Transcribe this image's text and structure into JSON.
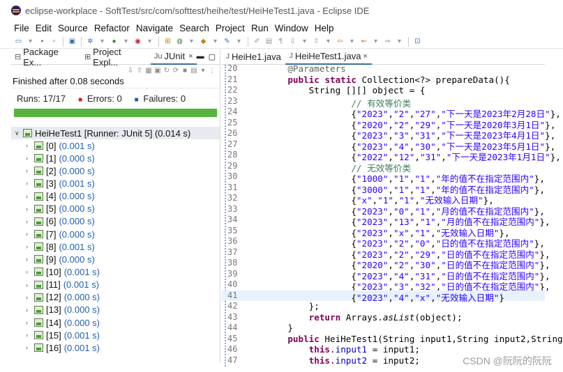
{
  "window": {
    "title": "eclipse-workplace - SoftTest/src/com/softtest/heihe/test/HeiHeTest1.java - Eclipse IDE"
  },
  "menu": [
    "File",
    "Edit",
    "Source",
    "Refactor",
    "Navigate",
    "Search",
    "Project",
    "Run",
    "Window",
    "Help"
  ],
  "left_tabs": [
    {
      "label": "Package Ex...",
      "icon": "package-explorer-icon"
    },
    {
      "label": "Project Expl...",
      "icon": "project-explorer-icon"
    },
    {
      "label": "JUnit",
      "icon": "junit-icon",
      "close": "×"
    }
  ],
  "junit": {
    "finished": "Finished after 0.08 seconds",
    "runs_label": "Runs:",
    "runs": "17/17",
    "errors_label": "Errors:",
    "errors": "0",
    "failures_label": "Failures:",
    "failures": "0",
    "progress": 1.0,
    "root": "HeiHeTest1 [Runner: JUnit 5] (0.014 s)",
    "cases": [
      {
        "name": "[0]",
        "time": "(0.001 s)"
      },
      {
        "name": "[1]",
        "time": "(0.000 s)"
      },
      {
        "name": "[2]",
        "time": "(0.000 s)"
      },
      {
        "name": "[3]",
        "time": "(0.001 s)"
      },
      {
        "name": "[4]",
        "time": "(0.000 s)"
      },
      {
        "name": "[5]",
        "time": "(0.000 s)"
      },
      {
        "name": "[6]",
        "time": "(0.000 s)"
      },
      {
        "name": "[7]",
        "time": "(0.000 s)"
      },
      {
        "name": "[8]",
        "time": "(0.001 s)"
      },
      {
        "name": "[9]",
        "time": "(0.000 s)"
      },
      {
        "name": "[10]",
        "time": "(0.001 s)"
      },
      {
        "name": "[11]",
        "time": "(0.001 s)"
      },
      {
        "name": "[12]",
        "time": "(0.000 s)"
      },
      {
        "name": "[13]",
        "time": "(0.000 s)"
      },
      {
        "name": "[14]",
        "time": "(0.000 s)"
      },
      {
        "name": "[15]",
        "time": "(0.001 s)"
      },
      {
        "name": "[16]",
        "time": "(0.001 s)"
      }
    ]
  },
  "editor_tabs": [
    {
      "label": "HeiHe1.java"
    },
    {
      "label": "HeiHeTest1.java",
      "close": "×"
    }
  ],
  "code_lines": [
    {
      "num": "20",
      "text": "    @Parameters"
    },
    {
      "num": "21",
      "text": "    public static Collection<?> prepareData(){"
    },
    {
      "num": "22",
      "text": "        String [][] object = {"
    },
    {
      "num": "23",
      "text": "                // 有效等价类"
    },
    {
      "num": "24",
      "text": "                {\"2023\",\"2\",\"27\",\"下一天是2023年2月28日\"},"
    },
    {
      "num": "25",
      "text": "                {\"2020\",\"2\",\"29\",\"下一天是2020年3月1日\"},"
    },
    {
      "num": "26",
      "text": "                {\"2023\",\"3\",\"31\",\"下一天是2023年4月1日\"},"
    },
    {
      "num": "27",
      "text": "                {\"2023\",\"4\",\"30\",\"下一天是2023年5月1日\"},"
    },
    {
      "num": "28",
      "text": "                {\"2022\",\"12\",\"31\",\"下一天是2023年1月1日\"},"
    },
    {
      "num": "29",
      "text": "                // 无效等价类"
    },
    {
      "num": "30",
      "text": "                {\"1000\",\"1\",\"1\",\"年的值不在指定范围内\"},"
    },
    {
      "num": "31",
      "text": "                {\"3000\",\"1\",\"1\",\"年的值不在指定范围内\"},"
    },
    {
      "num": "32",
      "text": "                {\"x\",\"1\",\"1\",\"无效输入日期\"},"
    },
    {
      "num": "33",
      "text": "                {\"2023\",\"0\",\"1\",\"月的值不在指定范围内\"},"
    },
    {
      "num": "34",
      "text": "                {\"2023\",\"13\",\"1\",\"月的值不在指定范围内\"},"
    },
    {
      "num": "35",
      "text": "                {\"2023\",\"x\",\"1\",\"无效输入日期\"},"
    },
    {
      "num": "36",
      "text": "                {\"2023\",\"2\",\"0\",\"日的值不在指定范围内\"},"
    },
    {
      "num": "37",
      "text": "                {\"2023\",\"2\",\"29\",\"日的值不在指定范围内\"},"
    },
    {
      "num": "38",
      "text": "                {\"2020\",\"2\",\"30\",\"日的值不在指定范围内\"},"
    },
    {
      "num": "39",
      "text": "                {\"2023\",\"4\",\"31\",\"日的值不在指定范围内\"},"
    },
    {
      "num": "40",
      "text": "                {\"2023\",\"3\",\"32\",\"日的值不在指定范围内\"},"
    },
    {
      "num": "41",
      "text": "                {\"2023\",\"4\",\"x\",\"无效输入日期\"}"
    },
    {
      "num": "42",
      "text": "        };"
    },
    {
      "num": "43",
      "text": "        return Arrays.asList(object);"
    },
    {
      "num": "44",
      "text": "    }"
    },
    {
      "num": "45",
      "text": "    public HeiHeTest1(String input1,String input2,String i"
    },
    {
      "num": "46",
      "text": "        this.input1 = input1;"
    },
    {
      "num": "47",
      "text": "        this.input2 = input2;"
    }
  ],
  "current_line": "41",
  "watermark": "CSDN @阮阮的阮阮",
  "colors": {
    "progress": "#56b340",
    "keyword": "#7f0055",
    "string": "#2a00ff",
    "comment": "#3f7f5f",
    "field": "#0000c0"
  }
}
